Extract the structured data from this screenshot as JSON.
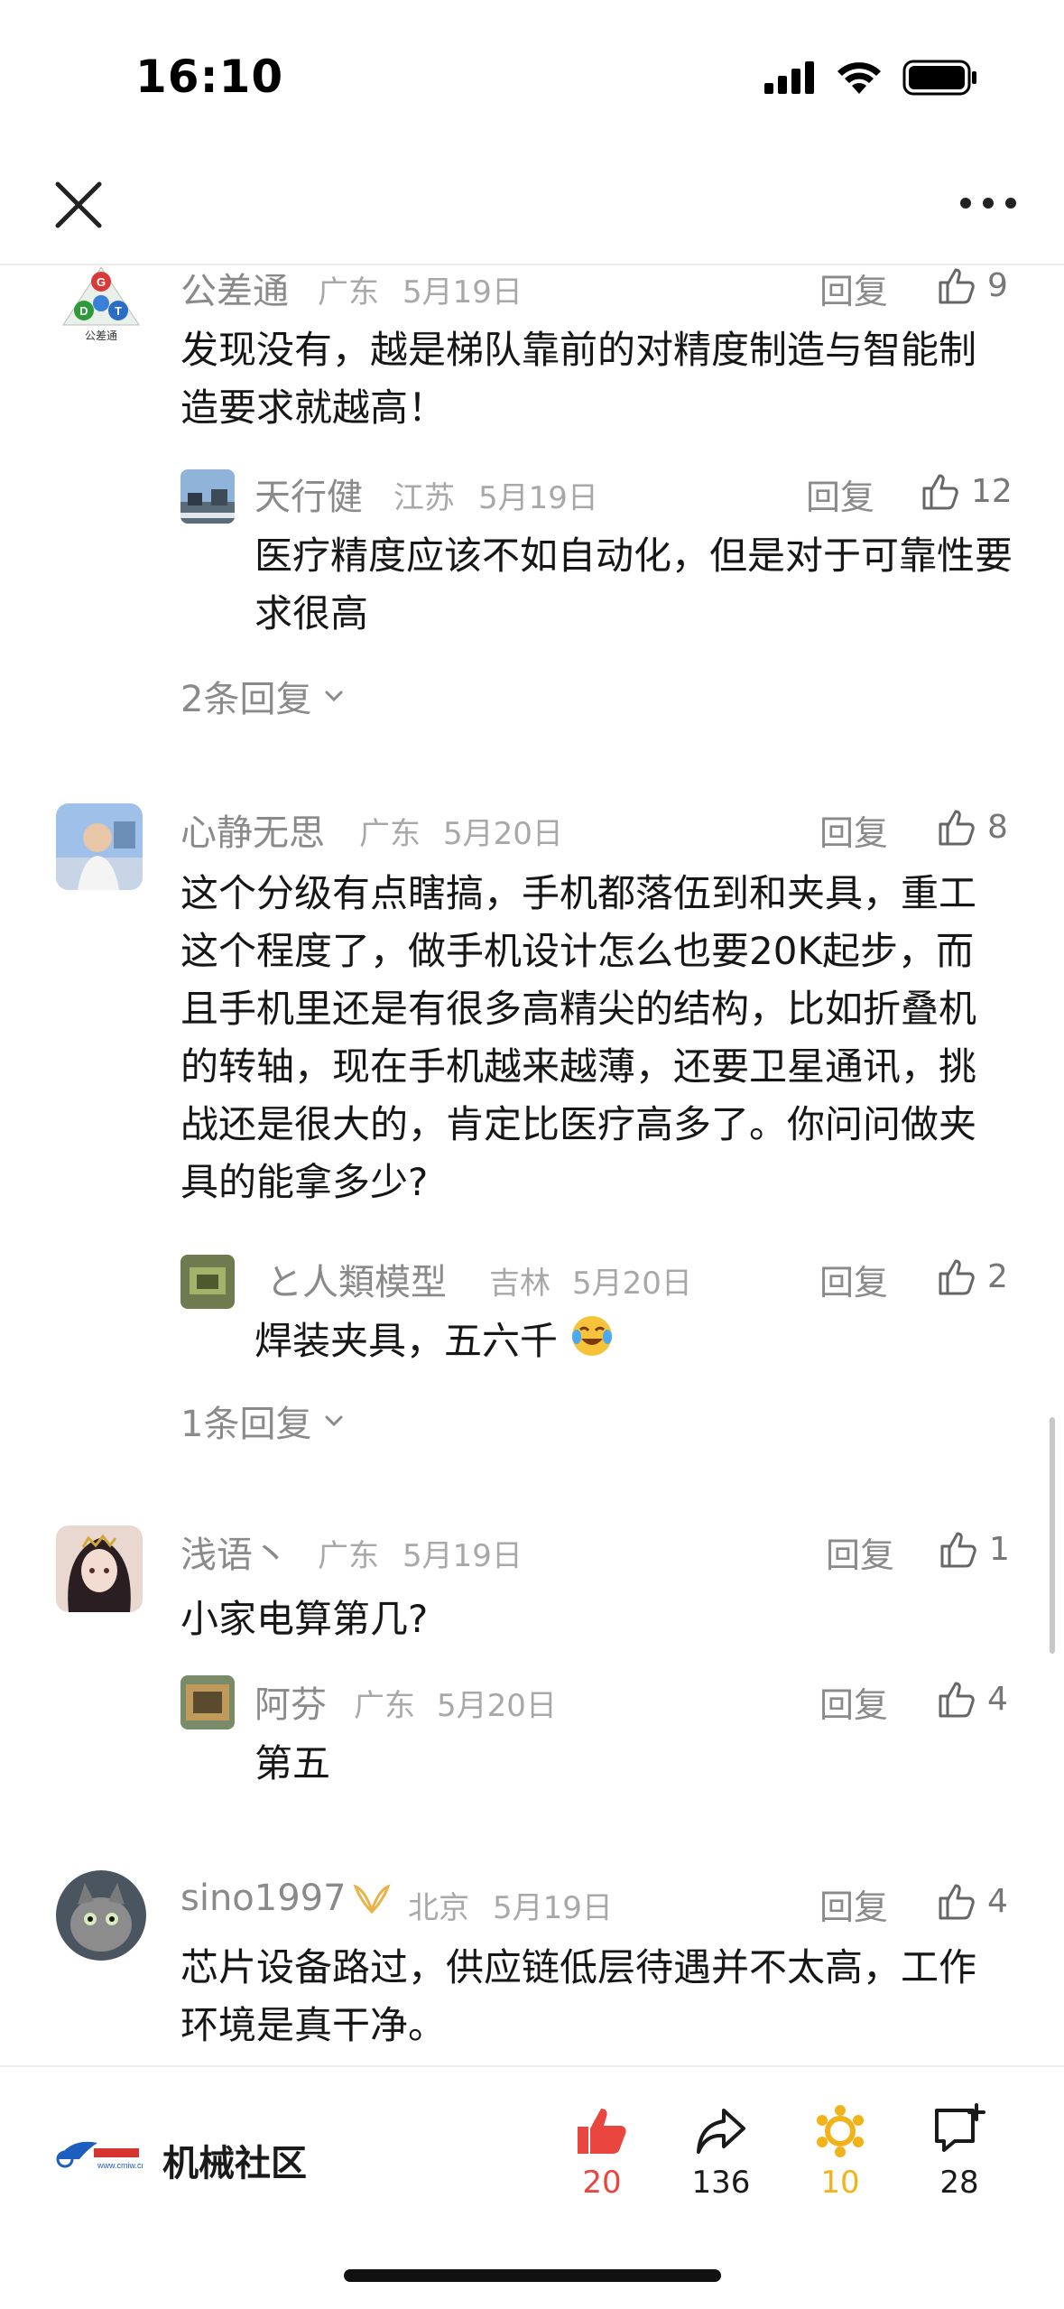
{
  "status_bar": {
    "time": "16:10"
  },
  "nav": {
    "close_icon": "close-icon",
    "more_icon": "more-horizontal-icon"
  },
  "comments": [
    {
      "user": "公差通",
      "region": "广东",
      "date": "5月19日",
      "reply": "回复",
      "likes": "9",
      "avatar_text": "公差通",
      "text": "发现没有，越是梯队靠前的对精度制造与智能制造要求就越高！",
      "replies": [
        {
          "user": "天行健",
          "region": "江苏",
          "date": "5月19日",
          "reply": "回复",
          "likes": "12",
          "text": "医疗精度应该不如自动化，但是对于可靠性要求很高"
        }
      ],
      "more": "2条回复"
    },
    {
      "user": "心静无思",
      "region": "广东",
      "date": "5月20日",
      "reply": "回复",
      "likes": "8",
      "text": "这个分级有点瞎搞，手机都落伍到和夹具，重工这个程度了，做手机设计怎么也要20K起步，而且手机里还是有很多高精尖的结构，比如折叠机的转轴，现在手机越来越薄，还要卫星通讯，挑战还是很大的，肯定比医疗高多了。你问问做夹具的能拿多少?",
      "replies": [
        {
          "user": "と人類模型",
          "region": "吉林",
          "date": "5月20日",
          "reply": "回复",
          "likes": "2",
          "text": "焊装夹具，五六千"
        }
      ],
      "more": "1条回复"
    },
    {
      "user": "浅语丶",
      "region": "广东",
      "date": "5月19日",
      "reply": "回复",
      "likes": "1",
      "text": "小家电算第几?",
      "replies": [
        {
          "user": "阿芬",
          "region": "广东",
          "date": "5月20日",
          "reply": "回复",
          "likes": "4",
          "text": "第五"
        }
      ]
    },
    {
      "user": "sino1997",
      "region": "北京",
      "date": "5月19日",
      "reply": "回复",
      "likes": "4",
      "text": "芯片设备路过，供应链低层待遇并不太高，工作环境是真干净。"
    }
  ],
  "bottom": {
    "brand": "机械社区",
    "logo_text": "www.cmiw.cn",
    "actions": [
      {
        "icon": "thumbs-up-filled-icon",
        "count": "20",
        "color": "#e8463f"
      },
      {
        "icon": "share-arrow-icon",
        "count": "136",
        "color": "#1a1a1a"
      },
      {
        "icon": "favorite-star-icon",
        "count": "10",
        "color": "#f2b31a"
      },
      {
        "icon": "comment-add-icon",
        "count": "28",
        "color": "#1a1a1a"
      }
    ]
  }
}
